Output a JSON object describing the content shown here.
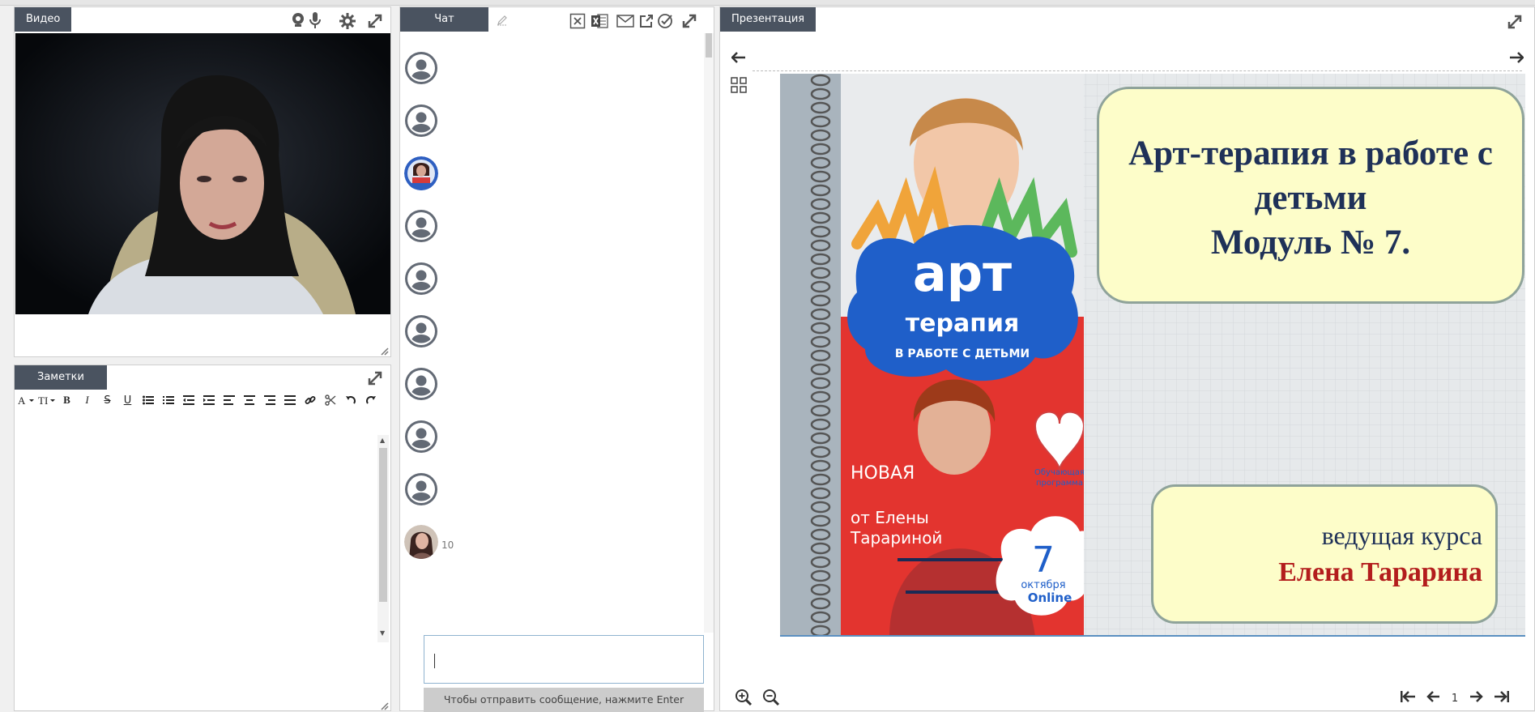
{
  "video": {
    "tab": "Видео"
  },
  "notes": {
    "tab": "Заметки"
  },
  "chat": {
    "tab": "Чат",
    "items": [
      {
        "kind": "default"
      },
      {
        "kind": "default"
      },
      {
        "kind": "photo"
      },
      {
        "kind": "default"
      },
      {
        "kind": "default"
      },
      {
        "kind": "default"
      },
      {
        "kind": "default"
      },
      {
        "kind": "default"
      },
      {
        "kind": "default"
      },
      {
        "kind": "photo",
        "count": "10"
      }
    ],
    "input_value": "",
    "send_hint": "Чтобы отправить сообщение, нажмите Enter"
  },
  "presentation": {
    "tab": "Презентация",
    "slide": {
      "title_lines": [
        "Арт-терапия в работе с",
        "детьми",
        "Модуль № 7."
      ],
      "host_label": "ведущая курса",
      "host_name": "Елена Тарарина",
      "cover": {
        "brand_top": "арт",
        "brand_bottom": "терапия",
        "subtitle": "В РАБОТЕ С ДЕТЬМИ",
        "new_label": "НОВАЯ",
        "author": [
          "от Елены",
          "Тарариной"
        ],
        "badge": [
          "Обучающая",
          "программа"
        ],
        "date_num": "7",
        "date_month": "октября",
        "date_online": "Online"
      }
    },
    "page_number": "1"
  },
  "colors": {
    "tab_bg": "#4a5360",
    "title_blue": "#1f3158",
    "host_red": "#b31d1d",
    "bubble_fill": "#fdfdc9",
    "cover_blue": "#1f5fc9",
    "cover_red": "#e3342f"
  }
}
